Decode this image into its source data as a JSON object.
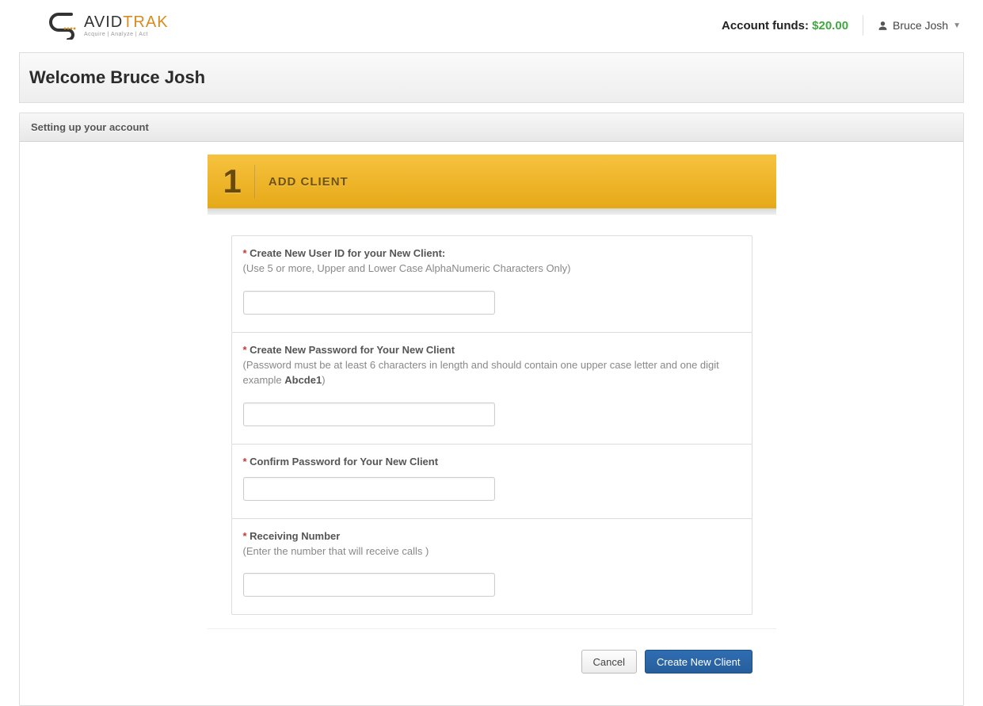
{
  "header": {
    "logo_line1_a": "AVID",
    "logo_line1_b": "TRAK",
    "logo_line2": "Acquire  |  Analyze  |  Act",
    "funds_label": "Account funds: ",
    "funds_amount": "$20.00",
    "user_name": "Bruce Josh"
  },
  "welcome_text": "Welcome Bruce Josh",
  "panel_title": "Setting up your account",
  "step": {
    "number": "1",
    "title": "ADD CLIENT"
  },
  "fields": {
    "user_id": {
      "label": "Create New User ID for your New Client:",
      "hint": "(Use 5 or more, Upper and Lower Case AlphaNumeric Characters Only)",
      "value": ""
    },
    "password": {
      "label": "Create New Password for Your New Client",
      "hint_a": "(Password must be at least 6 characters in length and should contain one upper case letter and one digit example ",
      "hint_bold": "Abcde1",
      "hint_b": ")",
      "value": ""
    },
    "confirm": {
      "label": "Confirm Password for Your New Client",
      "value": ""
    },
    "receiving": {
      "label": "Receiving Number",
      "hint": "(Enter the number that will receive calls )",
      "value": ""
    }
  },
  "buttons": {
    "cancel": "Cancel",
    "create": "Create New Client"
  }
}
